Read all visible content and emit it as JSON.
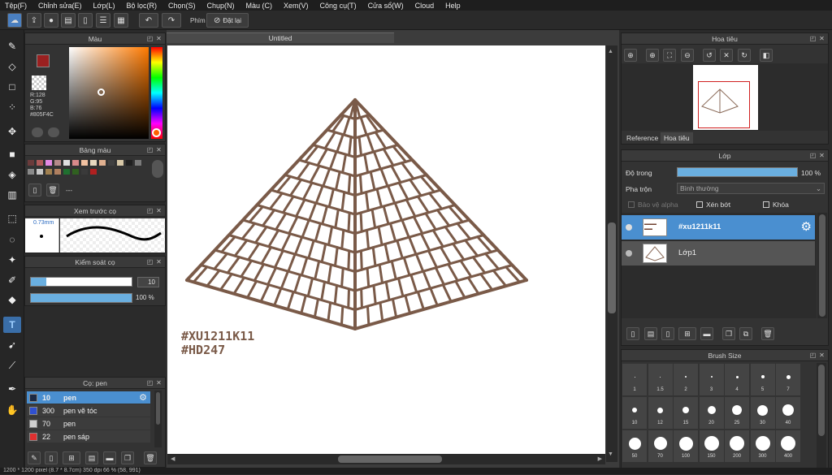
{
  "menu": [
    "Tệp(F)",
    "Chỉnh sửa(E)",
    "Lớp(L)",
    "Bộ lọc(R)",
    "Chọn(S)",
    "Chụp(N)",
    "Màu (C)",
    "Xem(V)",
    "Công cụ(T)",
    "Cửa sổ(W)",
    "Cloud",
    "Help"
  ],
  "toolbar": {
    "phim_label": "Phím",
    "reset_label": "Đặt lại"
  },
  "canvas_tab": "Untitled",
  "color_panel": {
    "title": "Màu",
    "r": "R:128",
    "g": "G:95",
    "b": "B:76",
    "hex": "#805F4C",
    "current_color": "#805f4c"
  },
  "palette_panel": {
    "title": "Bảng màu",
    "value": "---",
    "colors": [
      "#6b3b3b",
      "#b05a5a",
      "#e58ae5",
      "#b58a8a",
      "#e0e0e0",
      "#d88a8a",
      "#f0c0a0",
      "#e8d8c0",
      "#e0b090",
      "#404040",
      "#d8c8a8",
      "#202020",
      "#7a7a7a",
      "#8a8a8a",
      "#c8c8c8",
      "#a08050",
      "#b08060",
      "#207030",
      "#306020",
      "#3a3a3a",
      "#b02020"
    ]
  },
  "preview_panel": {
    "title": "Xem trước cọ",
    "size": "0.73mm"
  },
  "brush_control": {
    "title": "Kiểm soát cọ",
    "size_value": "10",
    "opacity_value": "100 %",
    "size_level": 0.15,
    "opacity_level": 1.0
  },
  "brush_list": {
    "title": "Cọ: pen",
    "items": [
      {
        "size": "10",
        "name": "pen",
        "color": "#1d2a44",
        "active": true
      },
      {
        "size": "300",
        "name": "pen vẽ tóc",
        "color": "#3050d0",
        "active": false
      },
      {
        "size": "70",
        "name": "pen",
        "color": "#d0d0d0",
        "active": false
      },
      {
        "size": "22",
        "name": "pen sáp",
        "color": "#e03030",
        "active": false
      }
    ]
  },
  "canvas": {
    "watermark1": "#XU1211K11",
    "watermark2": "#HD247",
    "stroke_color": "#7a5a48"
  },
  "navigator": {
    "title": "Hoa tiêu",
    "tab_reference": "Reference",
    "tab_navigator": "Hoa tiêu"
  },
  "layer_panel": {
    "title": "Lớp",
    "opacity_label": "Độ trong",
    "opacity_value": "100 %",
    "opacity_level": 1.0,
    "blend_label": "Pha trộn",
    "blend_value": "Bình thường",
    "protect_alpha": "Bảo vệ alpha",
    "clipping": "Xén bớt",
    "lock": "Khóa",
    "layers": [
      {
        "name": "#xu1211k11",
        "active": true
      },
      {
        "name": "Lớp1",
        "active": false
      }
    ]
  },
  "brush_size": {
    "title": "Brush Size",
    "labels": [
      "1",
      "1.5",
      "2",
      "3",
      "4",
      "5",
      "7",
      "10",
      "12",
      "15",
      "20",
      "25",
      "30",
      "40",
      "50",
      "70",
      "100",
      "150",
      "200",
      "300",
      "400"
    ]
  },
  "status": "1200 * 1200 pixel  (8.7 * 8.7cm)  350 dpi  66 %  (58, 991)"
}
